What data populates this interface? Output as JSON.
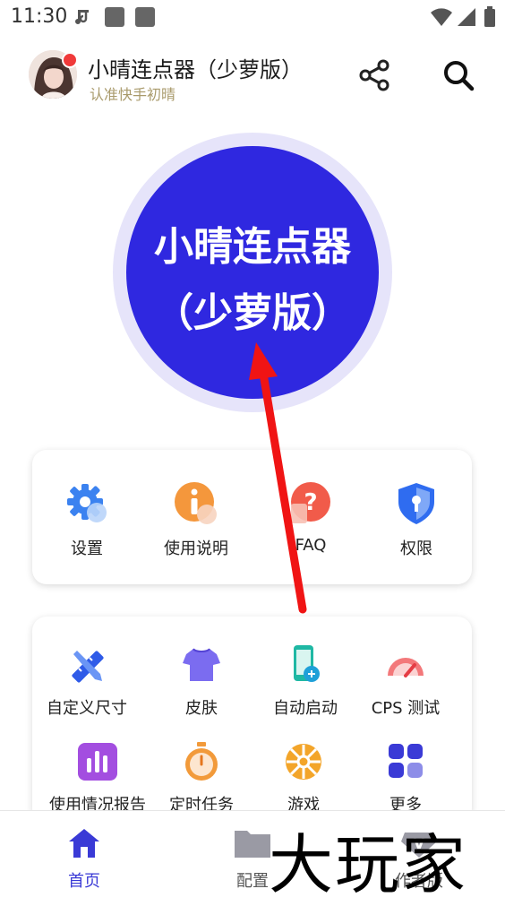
{
  "status_bar": {
    "time": "11:30"
  },
  "header": {
    "title": "小晴连点器（少萝版）",
    "subtitle": "认准快手初晴",
    "icons": [
      "avatar",
      "notification-dot",
      "share-icon",
      "search-icon"
    ]
  },
  "main_button": {
    "line1": "小晴连点器",
    "line2": "（少萝版）"
  },
  "quick_menu": {
    "items": [
      {
        "label": "设置",
        "icon": "gear-icon"
      },
      {
        "label": "使用说明",
        "icon": "info-icon"
      },
      {
        "label": "FAQ",
        "icon": "question-icon"
      },
      {
        "label": "权限",
        "icon": "shield-icon"
      }
    ]
  },
  "tools_menu": {
    "items": [
      {
        "label": "自定义尺寸",
        "icon": "ruler-pencil-icon"
      },
      {
        "label": "皮肤",
        "icon": "tshirt-icon"
      },
      {
        "label": "自动启动",
        "icon": "phone-link-icon"
      },
      {
        "label": "CPS 测试",
        "icon": "speedometer-icon"
      },
      {
        "label": "使用情况报告",
        "icon": "bar-chart-icon"
      },
      {
        "label": "定时任务",
        "icon": "stopwatch-icon"
      },
      {
        "label": "游戏",
        "icon": "wheel-icon"
      },
      {
        "label": "更多",
        "icon": "grid-icon"
      }
    ]
  },
  "bottom_nav": {
    "items": [
      {
        "label": "首页",
        "icon": "home-icon",
        "active": true
      },
      {
        "label": "配置",
        "icon": "folder-icon",
        "active": false
      },
      {
        "label": "作者版",
        "icon": "vip-icon",
        "active": false
      }
    ]
  },
  "watermark": "大玩家",
  "colors": {
    "accent": "#2f28e0",
    "nav_active": "#3a3ad6",
    "arrow": "#f01414"
  }
}
